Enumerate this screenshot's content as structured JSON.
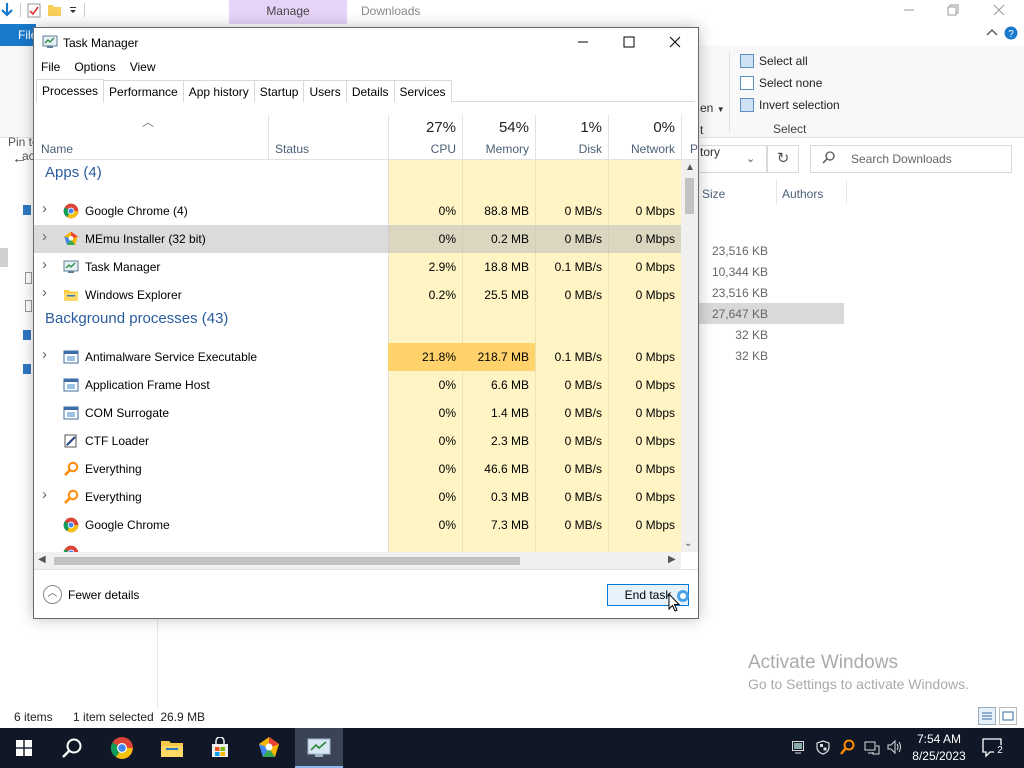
{
  "explorer": {
    "manage_tab": "Manage",
    "title": "Downloads",
    "file_tab": "File",
    "ribbon": {
      "partial_open": "en",
      "partial_t": "t",
      "partial_history": "tory",
      "select_all": "Select all",
      "select_none": "Select none",
      "invert_selection": "Invert selection",
      "select_group": "Select"
    },
    "pin_label_1": "Pin to",
    "pin_label_2": "ac",
    "search_placeholder": "Search Downloads",
    "columns": [
      "Size",
      "Authors"
    ],
    "sizes": [
      "23,516 KB",
      "10,344 KB",
      "23,516 KB",
      "27,647 KB",
      "32 KB",
      "32 KB"
    ],
    "status_items": "6 items",
    "status_selected": "1 item selected  26.9 MB",
    "activate_title": "Activate Windows",
    "activate_sub": "Go to Settings to activate Windows."
  },
  "taskmanager": {
    "title": "Task Manager",
    "menu": [
      "File",
      "Options",
      "View"
    ],
    "tabs": [
      "Processes",
      "Performance",
      "App history",
      "Startup",
      "Users",
      "Details",
      "Services"
    ],
    "columns": {
      "name": "Name",
      "status": "Status",
      "cpu_pct": "27%",
      "cpu": "CPU",
      "memory_pct": "54%",
      "memory": "Memory",
      "disk_pct": "1%",
      "disk": "Disk",
      "network_pct": "0%",
      "network": "Network",
      "power_partial": "P"
    },
    "groups": {
      "apps": "Apps (4)",
      "background": "Background processes (43)"
    },
    "apps": [
      {
        "name": "Google Chrome (4)",
        "cpu": "0%",
        "memory": "88.8 MB",
        "disk": "0 MB/s",
        "network": "0 Mbps",
        "icon": "chrome-icon",
        "expandable": true
      },
      {
        "name": "MEmu Installer (32 bit)",
        "cpu": "0%",
        "memory": "0.2 MB",
        "disk": "0 MB/s",
        "network": "0 Mbps",
        "icon": "memu-icon",
        "expandable": true
      },
      {
        "name": "Task Manager",
        "cpu": "2.9%",
        "memory": "18.8 MB",
        "disk": "0.1 MB/s",
        "network": "0 Mbps",
        "icon": "task-manager-icon",
        "expandable": true
      },
      {
        "name": "Windows Explorer",
        "cpu": "0.2%",
        "memory": "25.5 MB",
        "disk": "0 MB/s",
        "network": "0 Mbps",
        "icon": "folder-icon",
        "expandable": true
      }
    ],
    "background": [
      {
        "name": "Antimalware Service Executable",
        "cpu": "21.8%",
        "memory": "218.7 MB",
        "disk": "0.1 MB/s",
        "network": "0 Mbps",
        "icon": "service-icon",
        "expandable": true
      },
      {
        "name": "Application Frame Host",
        "cpu": "0%",
        "memory": "6.6 MB",
        "disk": "0 MB/s",
        "network": "0 Mbps",
        "icon": "service-icon",
        "expandable": false
      },
      {
        "name": "COM Surrogate",
        "cpu": "0%",
        "memory": "1.4 MB",
        "disk": "0 MB/s",
        "network": "0 Mbps",
        "icon": "service-icon",
        "expandable": false
      },
      {
        "name": "CTF Loader",
        "cpu": "0%",
        "memory": "2.3 MB",
        "disk": "0 MB/s",
        "network": "0 Mbps",
        "icon": "ctf-icon",
        "expandable": false
      },
      {
        "name": "Everything",
        "cpu": "0%",
        "memory": "46.6 MB",
        "disk": "0 MB/s",
        "network": "0 Mbps",
        "icon": "everything-icon",
        "expandable": false
      },
      {
        "name": "Everything",
        "cpu": "0%",
        "memory": "0.3 MB",
        "disk": "0 MB/s",
        "network": "0 Mbps",
        "icon": "everything-icon",
        "expandable": true
      },
      {
        "name": "Google Chrome",
        "cpu": "0%",
        "memory": "7.3 MB",
        "disk": "0 MB/s",
        "network": "0 Mbps",
        "icon": "chrome-icon",
        "expandable": false
      }
    ],
    "fewer_details": "Fewer details",
    "end_task": "End task"
  },
  "taskbar": {
    "time": "7:54 AM",
    "date": "8/25/2023",
    "notification_count": "2"
  },
  "colors": {
    "accent": "#0078d7",
    "group_text": "#2a5d9f",
    "heat_low": "#fff4c4",
    "heat_high": "#ffd26b",
    "taskbar": "#101828"
  }
}
